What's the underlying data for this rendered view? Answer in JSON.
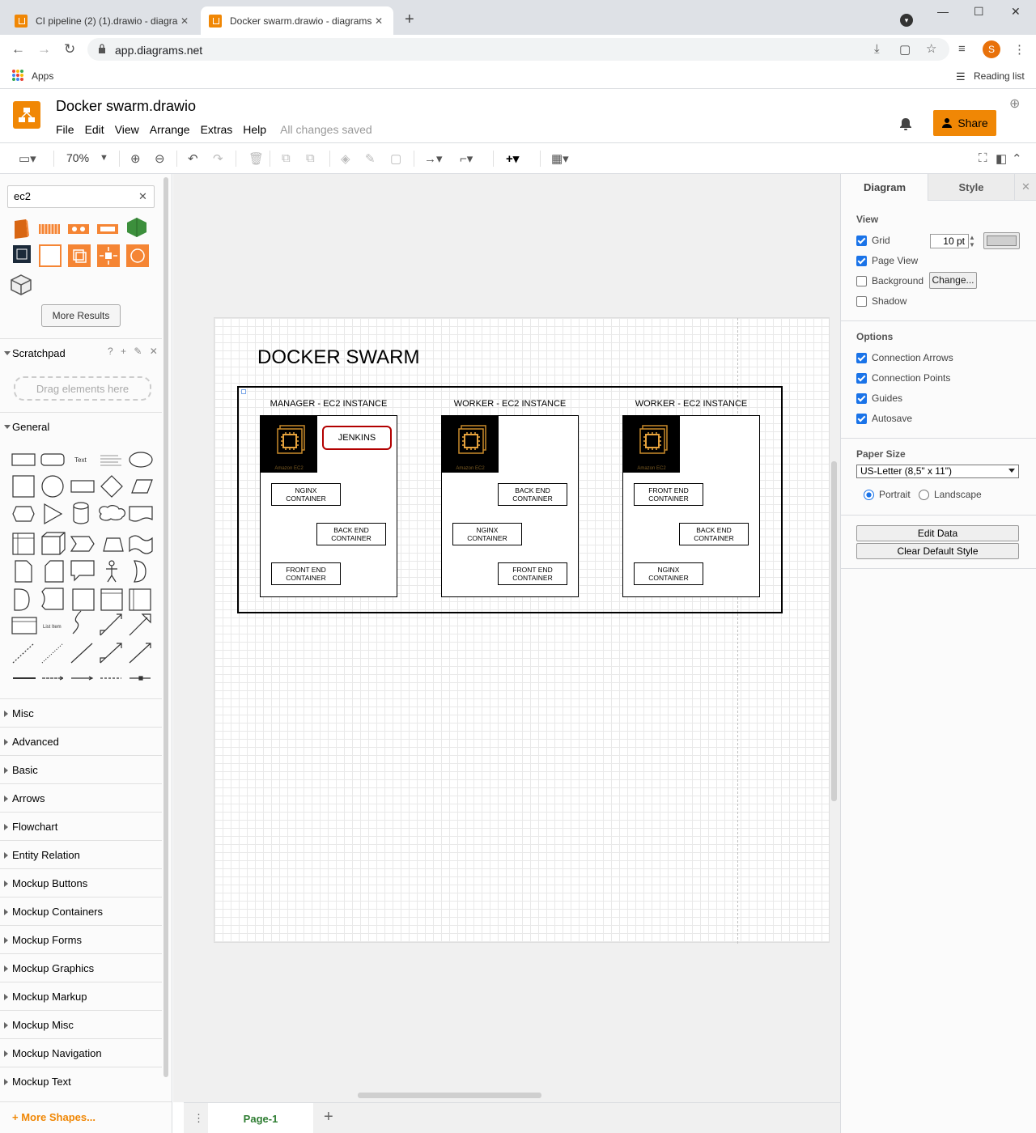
{
  "browser": {
    "tabs": [
      {
        "title": "CI pipeline (2) (1).drawio - diagra",
        "active": false
      },
      {
        "title": "Docker swarm.drawio - diagrams",
        "active": true
      }
    ],
    "url": "app.diagrams.net",
    "profile_initial": "S",
    "bookmarks": {
      "apps": "Apps",
      "reading_list": "Reading list"
    }
  },
  "app": {
    "doc_title": "Docker swarm.drawio",
    "menu": [
      "File",
      "Edit",
      "View",
      "Arrange",
      "Extras",
      "Help"
    ],
    "save_status": "All changes saved",
    "share_label": "Share",
    "brand_color": "#f08705"
  },
  "toolbar": {
    "zoom": "70%"
  },
  "sidebar": {
    "search_value": "ec2",
    "more_results": "More Results",
    "scratchpad": "Scratchpad",
    "scratchpad_icons": "? + ✎ ✕",
    "drag_hint": "Drag elements here",
    "general": "General",
    "shape_text_label": "Text",
    "shape_list_label": "List Item",
    "sections": [
      "Misc",
      "Advanced",
      "Basic",
      "Arrows",
      "Flowchart",
      "Entity Relation",
      "Mockup Buttons",
      "Mockup Containers",
      "Mockup Forms",
      "Mockup Graphics",
      "Mockup Markup",
      "Mockup Misc",
      "Mockup Navigation",
      "Mockup Text"
    ],
    "more_shapes": "More Shapes..."
  },
  "diagram": {
    "title": "DOCKER SWARM",
    "ec2_caption": "Amazon EC2",
    "instances": [
      {
        "label": "MANAGER - EC2 INSTANCE",
        "jenkins": "JENKINS",
        "containers": [
          "NGINX\nCONTAINER",
          "BACK END\nCONTAINER",
          "FRONT END\nCONTAINER"
        ]
      },
      {
        "label": "WORKER - EC2 INSTANCE",
        "containers": [
          "BACK END\nCONTAINER",
          "NGINX\nCONTAINER",
          "FRONT END\nCONTAINER"
        ]
      },
      {
        "label": "WORKER - EC2 INSTANCE",
        "containers": [
          "FRONT END\nCONTAINER",
          "BACK END\nCONTAINER",
          "NGINX\nCONTAINER"
        ]
      }
    ],
    "jenkins_border": "#b20000"
  },
  "pages": {
    "current": "Page-1"
  },
  "format_panel": {
    "tabs": [
      "Diagram",
      "Style"
    ],
    "view_heading": "View",
    "grid": {
      "label": "Grid",
      "checked": true,
      "size": "10 pt"
    },
    "page_view": {
      "label": "Page View",
      "checked": true
    },
    "background": {
      "label": "Background",
      "checked": false,
      "button": "Change..."
    },
    "shadow": {
      "label": "Shadow",
      "checked": false
    },
    "options_heading": "Options",
    "options": [
      {
        "label": "Connection Arrows",
        "checked": true
      },
      {
        "label": "Connection Points",
        "checked": true
      },
      {
        "label": "Guides",
        "checked": true
      },
      {
        "label": "Autosave",
        "checked": true
      }
    ],
    "paper_heading": "Paper Size",
    "paper_size": "US-Letter (8,5\" x 11\")",
    "orientation": {
      "portrait": "Portrait",
      "landscape": "Landscape",
      "selected": "Portrait"
    },
    "edit_data": "Edit Data",
    "clear_style": "Clear Default Style"
  }
}
